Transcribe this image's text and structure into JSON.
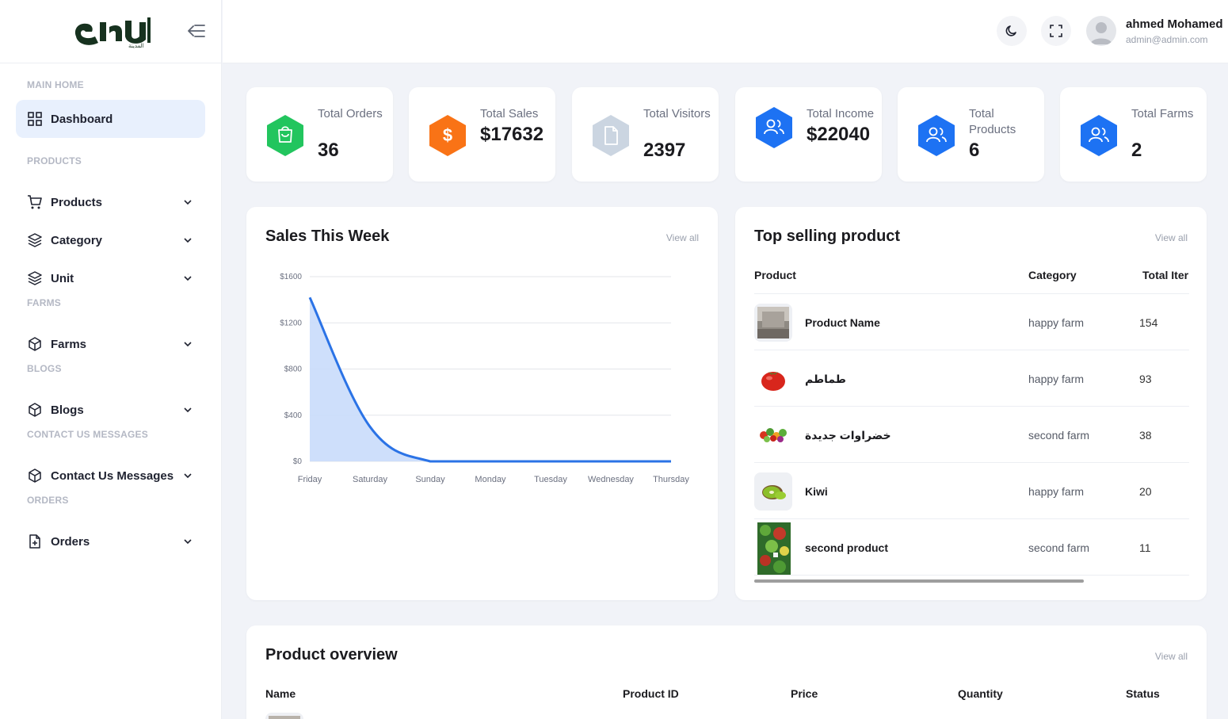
{
  "sidebar": {
    "logo_text": "مزارع المدينة",
    "sections": {
      "main_home": "MAIN HOME",
      "products": "PRODUCTS",
      "farms": "FARMS",
      "blogs": "BLOGS",
      "contact": "CONTACT US MESSAGES",
      "orders": "ORDERS"
    },
    "items": {
      "dashboard": "Dashboard",
      "products": "Products",
      "category": "Category",
      "unit": "Unit",
      "farms": "Farms",
      "blogs": "Blogs",
      "contact": "Contact Us Messages",
      "orders": "Orders"
    }
  },
  "topbar": {
    "user_name": "ahmed Mohamed",
    "user_email": "admin@admin.com"
  },
  "stats": [
    {
      "label": "Total Orders",
      "value": "36",
      "color": "#22c55e",
      "icon": "bag-icon"
    },
    {
      "label": "Total Sales",
      "value": "$17632",
      "color": "#f97316",
      "icon": "dollar-icon"
    },
    {
      "label": "Total Visitors",
      "value": "2397",
      "color": "#cbd5e1",
      "icon": "file-icon"
    },
    {
      "label": "Total Income",
      "value": "$22040",
      "color": "#1d72f3",
      "icon": "users-icon"
    },
    {
      "label": "Total Products",
      "value": "6",
      "color": "#1d72f3",
      "icon": "users-icon"
    },
    {
      "label": "Total Farms",
      "value": "2",
      "color": "#1d72f3",
      "icon": "users-icon"
    }
  ],
  "sales_panel": {
    "title": "Sales This Week",
    "view_all": "View all"
  },
  "chart_data": {
    "type": "area",
    "categories": [
      "Friday",
      "Saturday",
      "Sunday",
      "Monday",
      "Tuesday",
      "Wednesday",
      "Thursday"
    ],
    "values": [
      1420,
      300,
      0,
      0,
      0,
      0,
      0
    ],
    "ylim": [
      0,
      1600
    ],
    "yticks": [
      "$0",
      "$400",
      "$800",
      "$1200",
      "$1600"
    ],
    "ytick_values": [
      0,
      400,
      800,
      1200,
      1600
    ],
    "line_color": "#2b73e6",
    "fill_color": "#c9dbfb",
    "grid": true
  },
  "top_selling": {
    "title": "Top selling product",
    "view_all": "View all",
    "columns": [
      "Product",
      "Category",
      "Total Iter"
    ],
    "rows": [
      {
        "name": "Product Name",
        "category": "happy farm",
        "total": "154"
      },
      {
        "name": "طماطم",
        "category": "happy farm",
        "total": "93"
      },
      {
        "name": "خضراوات جديدة",
        "category": "second farm",
        "total": "38"
      },
      {
        "name": "Kiwi",
        "category": "happy farm",
        "total": "20"
      },
      {
        "name": "second product",
        "category": "second farm",
        "total": "11"
      }
    ]
  },
  "overview": {
    "title": "Product overview",
    "view_all": "View all",
    "columns": [
      "Name",
      "Product ID",
      "Price",
      "Quantity",
      "Status"
    ]
  }
}
